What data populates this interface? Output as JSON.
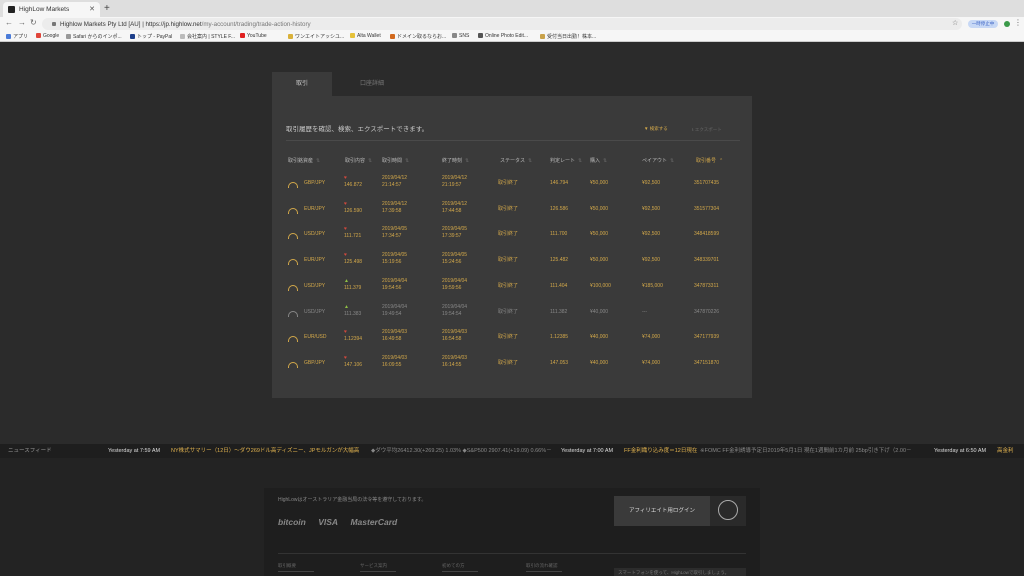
{
  "browser": {
    "tab_title": "HighLow Markets",
    "url_host": "https://jp.highlow.net",
    "url_path": "/my-account/trading/trade-action-history",
    "url_org": "Highlow Markets Pty Ltd [AU]",
    "profile_pill": "一時停止中",
    "bookmarks": [
      "アプリ",
      "Google",
      "Safari からのインポ...",
      "トップ - PayPal",
      "会社案内 | STYLE F...",
      "YouTube",
      "ワンエイトアッシユ...",
      "Alta Wallet",
      "ドメイン取るならお...",
      "SNS",
      "Online Photo Edit...",
      "受付当日出勤！株本..."
    ]
  },
  "tabs": [
    "取引",
    "口座詳細"
  ],
  "panel": {
    "description": "取引履歴を確認、検索、エクスポートできます。",
    "filter_label": "検索する",
    "export_label": "エクスポート"
  },
  "table": {
    "headers": [
      "取引銘資産",
      "取引内容",
      "取引時間",
      "終了時刻",
      "ステータス",
      "判定レート",
      "購入",
      "ペイアウト",
      "取引番号"
    ],
    "rows": [
      {
        "asset": "GBP/JPY",
        "dir": "down",
        "entry": "146.872",
        "start_date": "2019/04/12",
        "start_time": "21:14:57",
        "end_date": "2019/04/12",
        "end_time": "21:19:57",
        "status": "取引終了",
        "rate": "146.794",
        "amount": "¥50,000",
        "payout": "¥92,500",
        "id": "351707435",
        "dim": false
      },
      {
        "asset": "EUR/JPY",
        "dir": "down",
        "entry": "126.590",
        "start_date": "2019/04/12",
        "start_time": "17:39:58",
        "end_date": "2019/04/12",
        "end_time": "17:44:58",
        "status": "取引終了",
        "rate": "126.586",
        "amount": "¥50,000",
        "payout": "¥92,500",
        "id": "351577304",
        "dim": false
      },
      {
        "asset": "USD/JPY",
        "dir": "down",
        "entry": "111.721",
        "start_date": "2019/04/05",
        "start_time": "17:34:57",
        "end_date": "2019/04/05",
        "end_time": "17:39:57",
        "status": "取引終了",
        "rate": "111.700",
        "amount": "¥50,000",
        "payout": "¥92,500",
        "id": "348418599",
        "dim": false
      },
      {
        "asset": "EUR/JPY",
        "dir": "down",
        "entry": "125.498",
        "start_date": "2019/04/05",
        "start_time": "15:19:56",
        "end_date": "2019/04/05",
        "end_time": "15:24:56",
        "status": "取引終了",
        "rate": "125.482",
        "amount": "¥50,000",
        "payout": "¥92,500",
        "id": "348339701",
        "dim": false
      },
      {
        "asset": "USD/JPY",
        "dir": "up",
        "entry": "111.379",
        "start_date": "2019/04/04",
        "start_time": "19:54:56",
        "end_date": "2019/04/04",
        "end_time": "19:59:56",
        "status": "取引終了",
        "rate": "111.404",
        "amount": "¥100,000",
        "payout": "¥185,000",
        "id": "347873311",
        "dim": false
      },
      {
        "asset": "USD/JPY",
        "dir": "up",
        "entry": "111.383",
        "start_date": "2019/04/04",
        "start_time": "19:49:54",
        "end_date": "2019/04/04",
        "end_time": "19:54:54",
        "status": "取引終了",
        "rate": "111.382",
        "amount": "¥40,000",
        "payout": "---",
        "id": "347870226",
        "dim": true
      },
      {
        "asset": "EUR/USD",
        "dir": "down",
        "entry": "1.12394",
        "start_date": "2019/04/03",
        "start_time": "16:49:58",
        "end_date": "2019/04/03",
        "end_time": "16:54:58",
        "status": "取引終了",
        "rate": "1.12385",
        "amount": "¥40,000",
        "payout": "¥74,000",
        "id": "347177939",
        "dim": false
      },
      {
        "asset": "GBP/JPY",
        "dir": "down",
        "entry": "147.106",
        "start_date": "2019/04/03",
        "start_time": "16:09:55",
        "end_date": "2019/04/03",
        "end_time": "16:14:55",
        "status": "取引終了",
        "rate": "147.053",
        "amount": "¥40,000",
        "payout": "¥74,000",
        "id": "347151870",
        "dim": false
      }
    ]
  },
  "ticker": {
    "label": "ニュースフィード",
    "items": [
      {
        "time": "Yesterday at 7:59 AM",
        "head": "NY株式サマリー（12日）～ダウ269ドル高ディズニー、JPモルガンが大幅高",
        "body": "◆ダウ平均26412.30(+269.25) 1.03% ◆S&P500 2907.41(+19.09) 0.66%－"
      },
      {
        "time": "Yesterday at 7:00 AM",
        "head": "FF金利織り込み度＝12日現在",
        "body": "※FOMC FF金利誘導予定日2019年5月1日 現在1週間前1カ月前 25bp引き下げ（2.00－"
      },
      {
        "time": "Yesterday at 6:50 AM",
        "head": "高金利"
      }
    ]
  },
  "footer": {
    "note": "HighLowはオーストラリア金融当局の法令等を遵守しております。",
    "logos": [
      "bitcoin",
      "VISA",
      "MasterCard"
    ],
    "affiliate_login": "アフィリエイト用ログイン",
    "links": [
      "取引概要",
      "サービス案内",
      "初めての方",
      "取引の流れ確認"
    ],
    "promo": "スマートフォンを使って、HighLowで取引しましょう。"
  }
}
